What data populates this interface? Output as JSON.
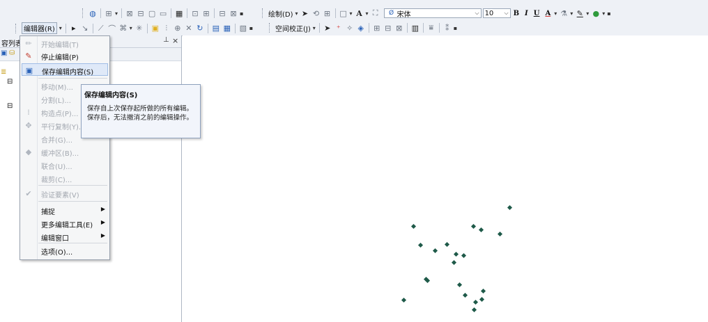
{
  "toolbar": {
    "draw_label": "绘制(D)",
    "font_name": "宋体",
    "font_size": "10",
    "bold": "B",
    "italic": "I",
    "underline": "U",
    "text_a": "A",
    "editor_label": "编辑器(R)",
    "spatial_adjust_label": "空间校正(J)"
  },
  "toc": {
    "title": "容列表",
    "pin": "ᵖ",
    "close": "×"
  },
  "menu": {
    "items": [
      {
        "label": "开始编辑(T)",
        "enabled": false,
        "icon": "pencil-icon"
      },
      {
        "label": "停止编辑(P)",
        "enabled": true,
        "icon": "stop-edit-pencil-icon"
      },
      {
        "label": "保存编辑内容(S)",
        "enabled": true,
        "icon": "save-edits-icon",
        "highlighted": true
      },
      {
        "label": "移动(M)...",
        "enabled": false
      },
      {
        "label": "分割(L)...",
        "enabled": false
      },
      {
        "label": "构造点(P)...",
        "enabled": false,
        "icon": "construct-points-icon"
      },
      {
        "label": "平行复制(Y)...",
        "enabled": false,
        "icon": "copy-parallel-icon"
      },
      {
        "label": "合并(G)...",
        "enabled": false
      },
      {
        "label": "缓冲区(B)...",
        "enabled": false,
        "icon": "buffer-icon"
      },
      {
        "label": "联合(U)...",
        "enabled": false
      },
      {
        "label": "裁剪(C)...",
        "enabled": false
      },
      {
        "label": "验证要素(V)",
        "enabled": false,
        "icon": "validate-features-icon"
      },
      {
        "label": "捕捉",
        "enabled": true,
        "submenu": true
      },
      {
        "label": "更多编辑工具(E)",
        "enabled": true,
        "submenu": true
      },
      {
        "label": "编辑窗口",
        "enabled": true,
        "submenu": true
      },
      {
        "label": "选项(O)...",
        "enabled": true
      }
    ],
    "submenu_arrow": "▶"
  },
  "tooltip": {
    "title": "保存编辑内容(S)",
    "body": "保存自上次保存起所做的所有编辑。保存后，无法撤消之前的编辑操作。"
  },
  "colors": {
    "point": "#1f5a49",
    "menu_highlight": "#dfe9f8",
    "tooltip_bg": "#f2f5fb"
  }
}
